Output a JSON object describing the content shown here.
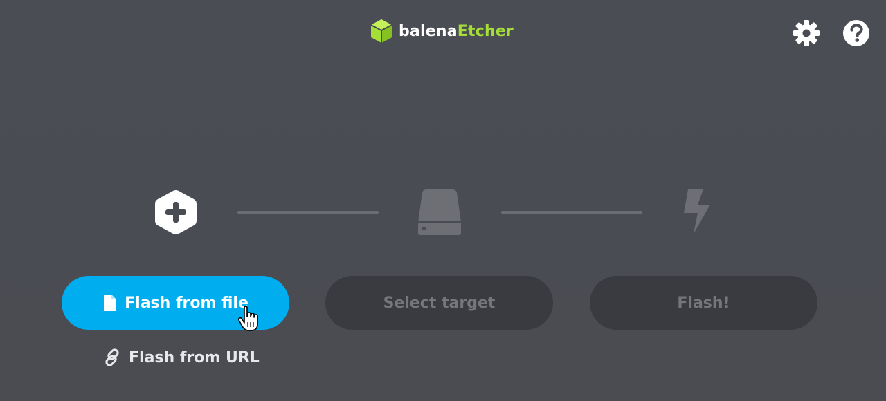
{
  "header": {
    "brand": "balena",
    "product": "Etcher",
    "settings_icon": "gear-icon",
    "help_icon": "question-circle-icon"
  },
  "steps": {
    "select_image_icon": "plus-hexagon-icon",
    "select_target_icon": "drive-icon",
    "flash_icon": "lightning-bolt-icon"
  },
  "buttons": {
    "flash_from_file": "Flash from file",
    "select_target": "Select target",
    "flash": "Flash!",
    "flash_from_url": "Flash from URL"
  },
  "colors": {
    "background": "#4a4c53",
    "accent": "#00aeef",
    "brand_green": "#a5de37",
    "disabled_button": "#3a3b40",
    "disabled_text": "#75777c"
  }
}
